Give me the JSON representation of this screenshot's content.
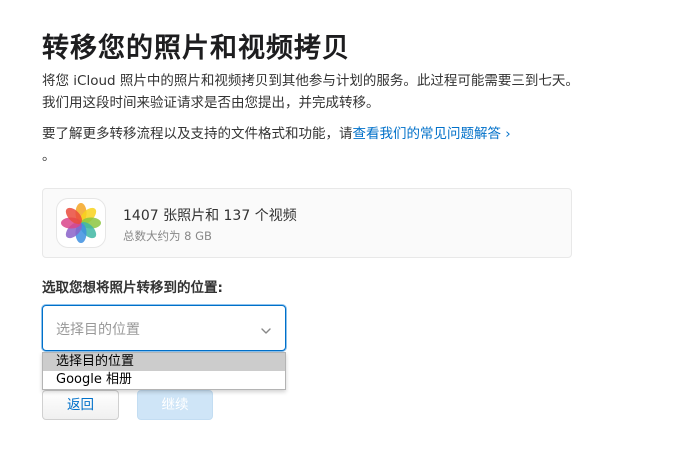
{
  "page": {
    "title": "转移您的照片和视频拷贝",
    "description": "将您 iCloud 照片中的照片和视频拷贝到其他参与计划的服务。此过程可能需要三到七天。我们用这段时间来验证请求是否由您提出，并完成转移。",
    "more_info_prefix": "要了解更多转移流程以及支持的文件格式和功能，请",
    "faq_link": "查看我们的常见问题解答 ›",
    "more_info_suffix": "。"
  },
  "summary": {
    "icon": "photos-app-icon",
    "count_text": "1407 张照片和 137 个视频",
    "size_text": "总数大约为 8 GB"
  },
  "destination": {
    "label": "选取您想将照片转移到的位置:",
    "placeholder": "选择目的位置",
    "options": [
      {
        "label": "选择目的位置",
        "selected": true
      },
      {
        "label": "Google 相册",
        "selected": false
      }
    ]
  },
  "buttons": {
    "back": "返回",
    "continue": "继续"
  },
  "colors": {
    "link": "#0070c9",
    "focus_border": "#0070c9",
    "disabled_button_bg": "#cfe5f7",
    "title": "#1d1d1f"
  }
}
